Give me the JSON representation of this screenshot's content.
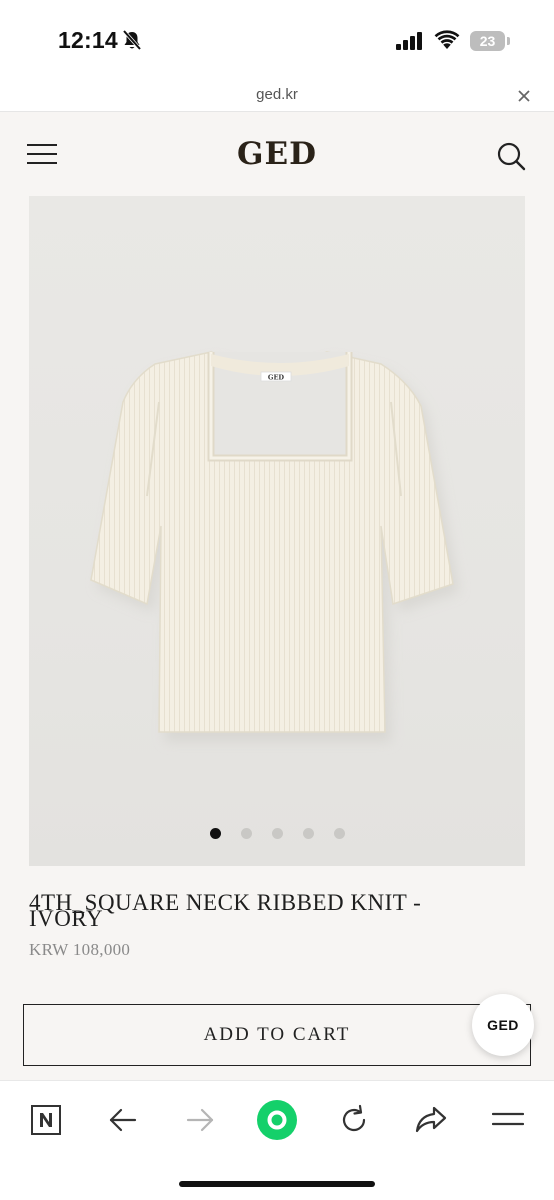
{
  "status_bar": {
    "time": "12:14",
    "battery_level": "23",
    "icons": [
      "bell-slash-icon",
      "signal-icon",
      "wifi-icon",
      "battery-icon"
    ]
  },
  "url_bar": {
    "url": "ged.kr",
    "close_icon": "close-icon"
  },
  "header": {
    "brand": "GED",
    "menu_icon": "hamburger-menu-icon",
    "search_icon": "search-icon"
  },
  "product": {
    "image_label": "GED",
    "image_count": 5,
    "active_image_index": 0,
    "title": "4TH_SQUARE NECK RIBBED KNIT - IVORY",
    "price": "KRW 108,000"
  },
  "actions": {
    "add_to_cart_label": "ADD TO CART",
    "chat_badge_label": "GED"
  },
  "toolbar": {
    "items": [
      "naver-home-icon",
      "back-icon",
      "forward-icon",
      "green-dot-icon",
      "reload-icon",
      "share-icon",
      "more-menu-icon"
    ]
  },
  "colors": {
    "page_bg": "#f7f5f3",
    "garment": "#f4efe3",
    "accent_green": "#14d06a",
    "text_dark": "#1e1e1e",
    "price_gray": "#8a8a8a"
  }
}
